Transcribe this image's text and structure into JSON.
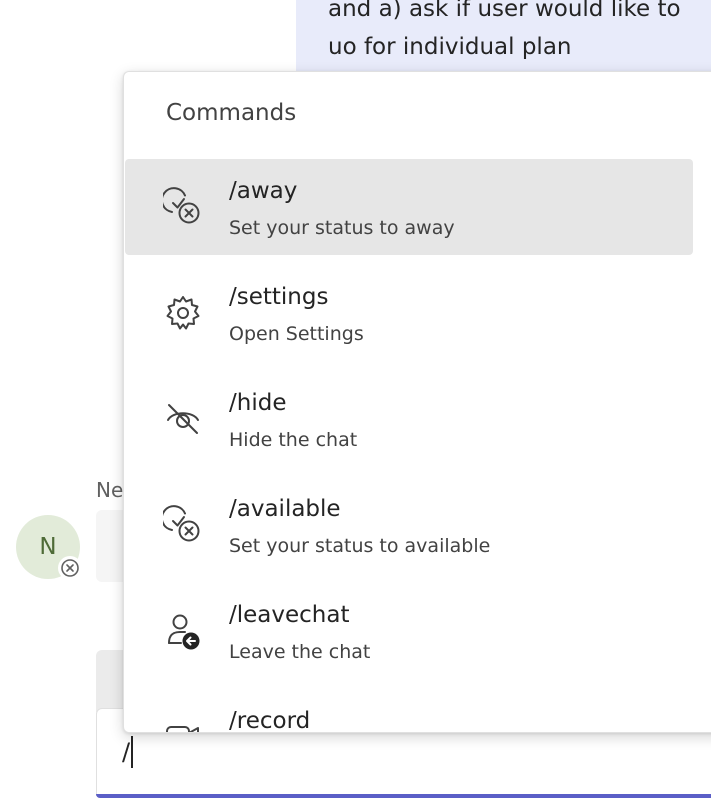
{
  "chat": {
    "message_lines": [
      "and  a) ask if user would like to",
      "uo for individual plan"
    ],
    "sender_name": "Ne",
    "avatar_initial": "N"
  },
  "compose": {
    "text": "/"
  },
  "commands": {
    "header": "Commands",
    "items": [
      {
        "title": "/away",
        "description": "Set your status to away",
        "icon": "status-away-icon",
        "selected": true
      },
      {
        "title": "/settings",
        "description": "Open Settings",
        "icon": "gear-icon",
        "selected": false
      },
      {
        "title": "/hide",
        "description": "Hide the chat",
        "icon": "eye-off-icon",
        "selected": false
      },
      {
        "title": "/available",
        "description": "Set your status to available",
        "icon": "status-available-icon",
        "selected": false
      },
      {
        "title": "/leavechat",
        "description": "Leave the chat",
        "icon": "person-leave-icon",
        "selected": false
      },
      {
        "title": "/record",
        "description": "",
        "icon": "video-camera-icon",
        "selected": false
      }
    ]
  },
  "colors": {
    "selected_bg": "#e6e6e6",
    "compose_accent": "#5b5fc7",
    "bubble_bg": "#e8ebfa",
    "avatar_bg": "#e2ebd9"
  }
}
